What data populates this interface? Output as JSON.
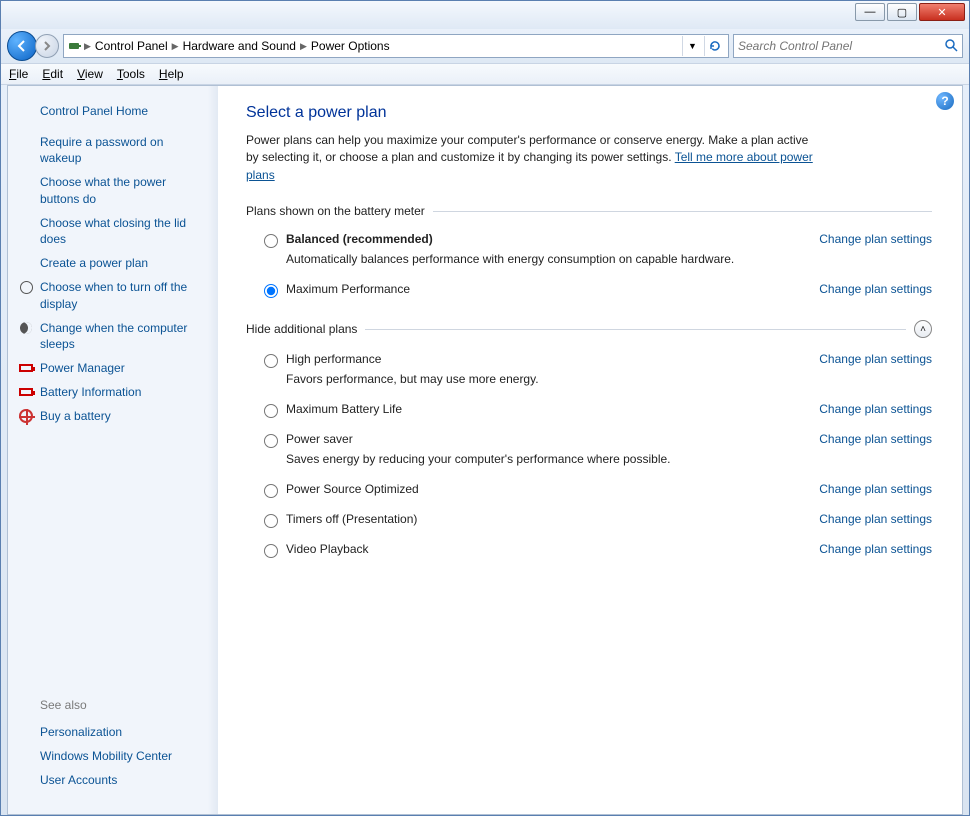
{
  "window_controls": {
    "minimize": "—",
    "maximize": "▢",
    "close": "✕"
  },
  "nav": {
    "breadcrumbs": [
      "Control Panel",
      "Hardware and Sound",
      "Power Options"
    ]
  },
  "search": {
    "placeholder": "Search Control Panel"
  },
  "menubar": [
    "File",
    "Edit",
    "View",
    "Tools",
    "Help"
  ],
  "sidebar": {
    "home": "Control Panel Home",
    "links": [
      {
        "label": "Require a password on wakeup",
        "icon": null
      },
      {
        "label": "Choose what the power buttons do",
        "icon": null
      },
      {
        "label": "Choose what closing the lid does",
        "icon": null
      },
      {
        "label": "Create a power plan",
        "icon": null
      },
      {
        "label": "Choose when to turn off the display",
        "icon": "clock"
      },
      {
        "label": "Change when the computer sleeps",
        "icon": "moon"
      },
      {
        "label": "Power Manager",
        "icon": "battery"
      },
      {
        "label": "Battery Information",
        "icon": "battery"
      },
      {
        "label": "Buy a battery",
        "icon": "globe"
      }
    ],
    "see_also_header": "See also",
    "see_also": [
      "Personalization",
      "Windows Mobility Center",
      "User Accounts"
    ]
  },
  "main": {
    "title": "Select a power plan",
    "intro_a": "Power plans can help you maximize your computer's performance or conserve energy. Make a plan active by selecting it, or choose a plan and customize it by changing its power settings. ",
    "intro_link": "Tell me more about power plans",
    "section1": "Plans shown on the battery meter",
    "section2": "Hide additional plans",
    "change_link": "Change plan settings",
    "plans_meter": [
      {
        "name": "Balanced (recommended)",
        "desc": "Automatically balances performance with energy consumption on capable hardware.",
        "selected": false,
        "bold": true
      },
      {
        "name": "Maximum Performance",
        "desc": "",
        "selected": true,
        "bold": false
      }
    ],
    "plans_additional": [
      {
        "name": "High performance",
        "desc": "Favors performance, but may use more energy."
      },
      {
        "name": "Maximum Battery Life",
        "desc": ""
      },
      {
        "name": "Power saver",
        "desc": "Saves energy by reducing your computer's performance where possible."
      },
      {
        "name": "Power Source Optimized",
        "desc": ""
      },
      {
        "name": "Timers off (Presentation)",
        "desc": ""
      },
      {
        "name": "Video Playback",
        "desc": ""
      }
    ]
  }
}
